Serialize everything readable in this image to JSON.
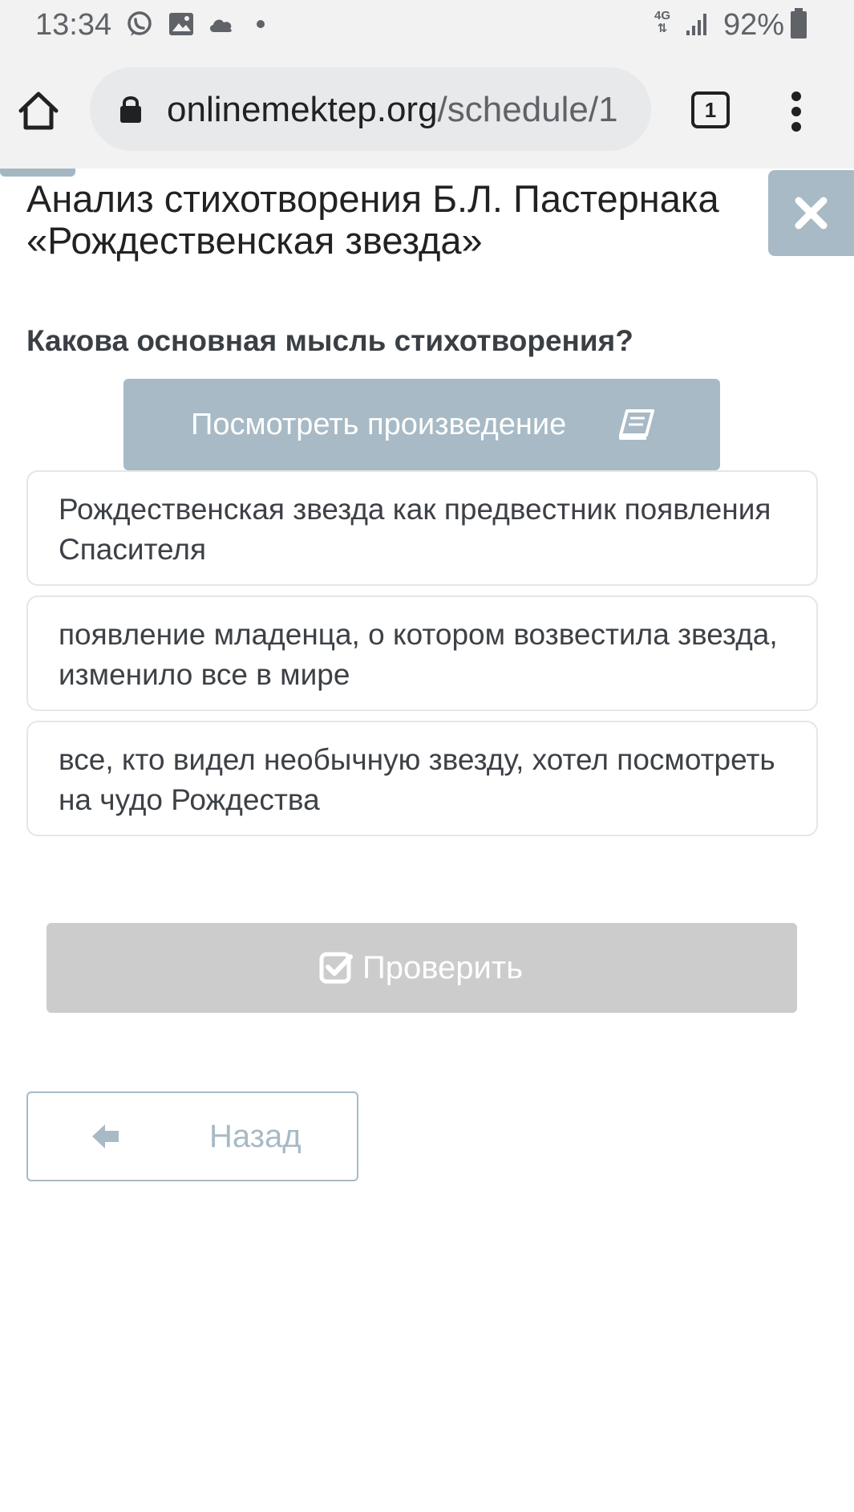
{
  "status_bar": {
    "time": "13:34",
    "network": "4G",
    "battery": "92%",
    "icons": [
      "whatsapp-icon",
      "gallery-icon",
      "cloud-icon",
      "notification-dot",
      "signal-icon",
      "battery-icon"
    ]
  },
  "browser": {
    "url_domain": "onlinemektep.org",
    "url_path": "/schedule/1",
    "tab_count": "1",
    "icons": [
      "home-icon",
      "lock-icon",
      "tabs-icon",
      "menu-icon"
    ]
  },
  "lesson": {
    "title": "Анализ стихотворения Б.Л. Пастернака «Рождественская звезда»",
    "close_icon": "close-icon"
  },
  "quiz": {
    "question": "Какова основная мысль стихотворения?",
    "view_work_label": "Посмотреть произведение",
    "view_work_icon": "book-icon",
    "options": [
      "Рождественская звезда как предвестник появления Спасителя",
      "появление младенца, о котором возвестила звезда, изменило все в мире",
      "все, кто видел необычную звезду, хотел посмотреть на чудо Рождества"
    ],
    "check_label": "Проверить",
    "check_icon": "check-square-icon",
    "back_label": "Назад",
    "back_icon": "arrow-left-icon"
  },
  "colors": {
    "accent": "#a7bac5",
    "disabled": "#cccccc",
    "option_border": "#e3e6ea"
  }
}
